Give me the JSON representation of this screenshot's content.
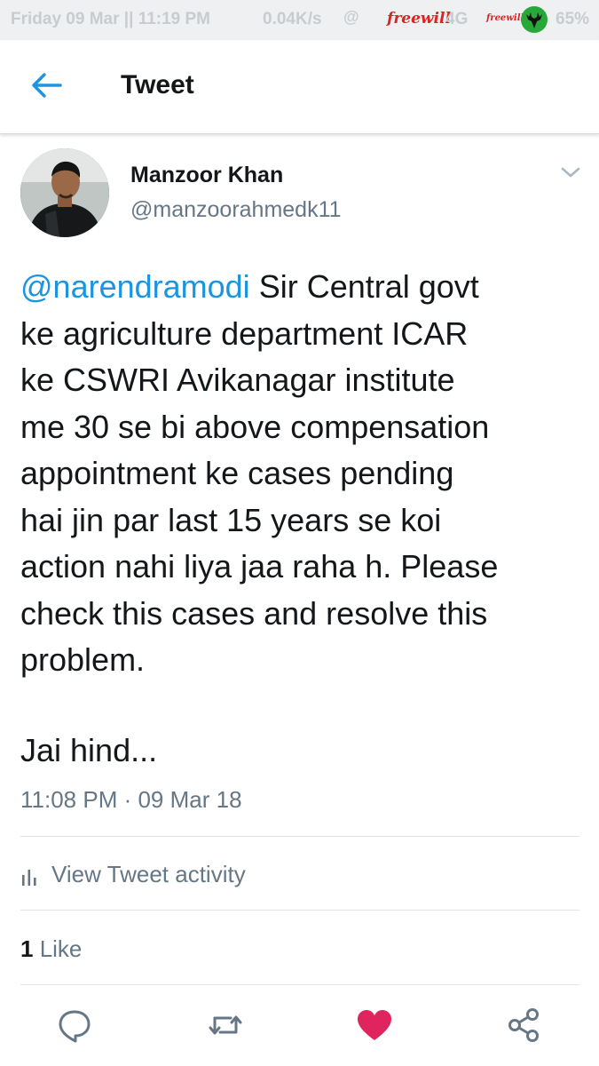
{
  "status_bar": {
    "left_text": "Friday 09 Mar || 11:19 PM",
    "speed": "0.04K/s",
    "at_symbol": "@",
    "carrier_logo": "freewill",
    "network": "4G",
    "carrier_logo_small": "freewill",
    "battery": "65%",
    "badge_icon": "deer-badge-icon"
  },
  "header": {
    "back_icon": "arrow-left-icon",
    "title": "Tweet"
  },
  "tweet": {
    "author_name": "Manzoor Khan",
    "author_handle": "@manzoorahmedk11",
    "mention": "@narendramodi",
    "lines": [
      " Sir Central govt",
      "ke agriculture department ICAR",
      "ke CSWRI Avikanagar institute",
      "me 30 se bi above compensation",
      "appointment ke cases pending",
      "hai jin par last 15 years se koi",
      "action nahi liya jaa raha h. Please",
      "check this cases and resolve this",
      "problem."
    ],
    "sign_off": "Jai hind...",
    "timestamp": "11:08 PM · 09 Mar 18",
    "activity_label": "View Tweet activity",
    "like_count": "1",
    "like_label": " Like"
  },
  "actions": {
    "reply_icon": "reply-icon",
    "retweet_icon": "retweet-icon",
    "like_icon": "heart-icon",
    "share_icon": "share-icon"
  },
  "colors": {
    "accent": "#1b95e0",
    "like": "#e0245e",
    "text": "#14171a",
    "muted": "#657786"
  }
}
